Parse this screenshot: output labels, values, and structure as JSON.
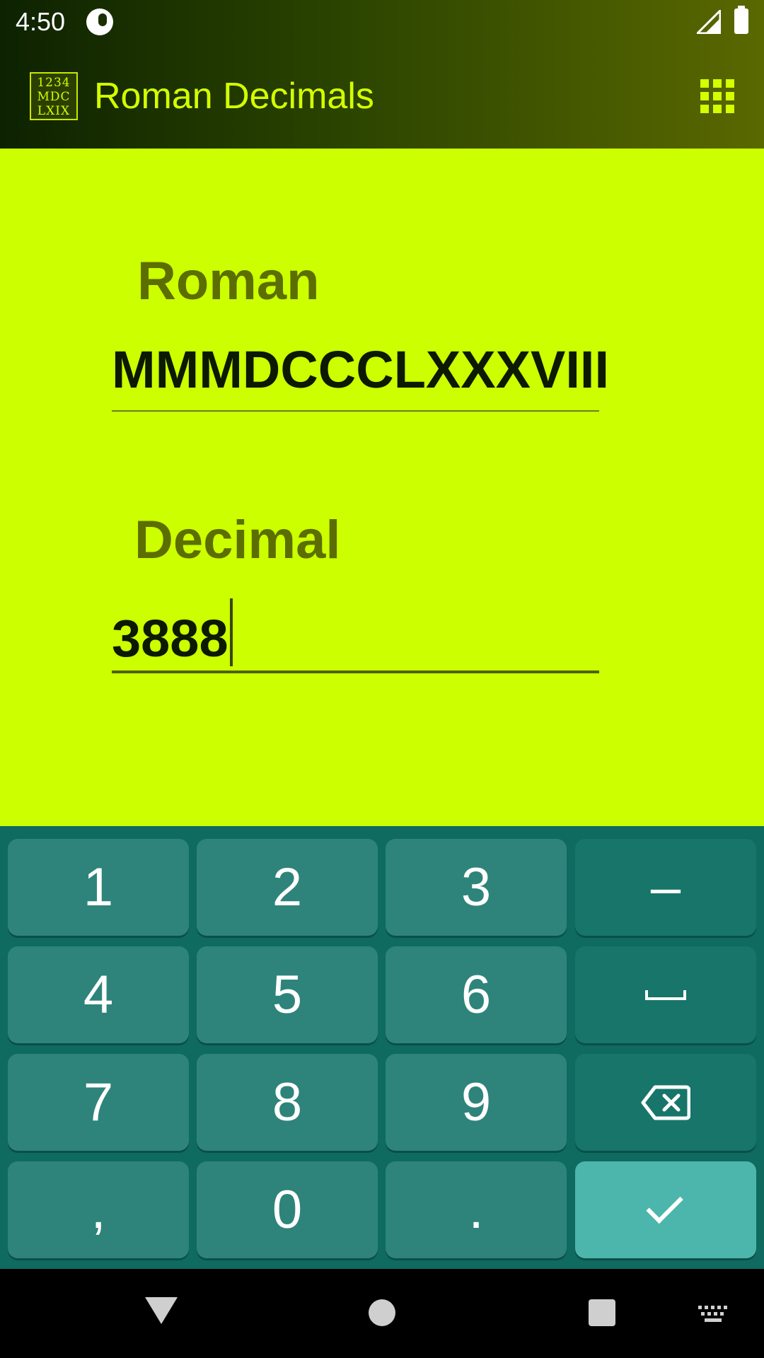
{
  "status_bar": {
    "time": "4:50",
    "icons": [
      "app-status-icon",
      "cell-signal-icon",
      "battery-icon"
    ]
  },
  "app_bar": {
    "logo_lines": [
      "1234",
      "MDC",
      "LXIX"
    ],
    "title": "Roman Decimals",
    "menu_icon": "grid-menu-icon"
  },
  "form": {
    "roman": {
      "label": "Roman",
      "value": "MMMDCCCLXXXVIII"
    },
    "decimal": {
      "label": "Decimal",
      "value": "3888"
    }
  },
  "keyboard": {
    "rows": [
      [
        "1",
        "2",
        "3",
        "–"
      ],
      [
        "4",
        "5",
        "6",
        "space"
      ],
      [
        "7",
        "8",
        "9",
        "backspace"
      ],
      [
        ",",
        "0",
        ".",
        "done"
      ]
    ]
  },
  "colors": {
    "content_bg": "#ccff00",
    "label": "#5c6e00",
    "title": "#d4ff00",
    "keyboard_bg": "#0f6a60",
    "key": "#2e847a",
    "enter_key": "#4db6ac"
  },
  "nav_bar": {
    "icons": [
      "back-icon",
      "home-icon",
      "recents-icon",
      "keyboard-switch-icon"
    ]
  }
}
